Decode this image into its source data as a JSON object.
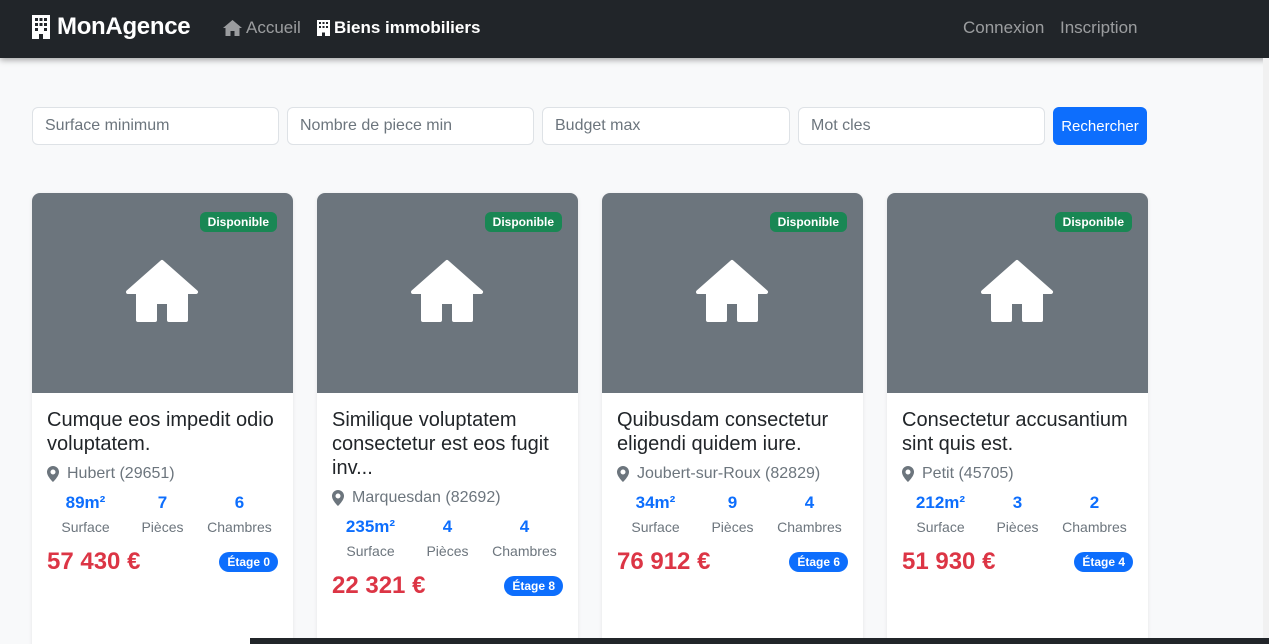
{
  "navbar": {
    "brand": "MonAgence",
    "links": [
      {
        "label": "Accueil"
      },
      {
        "label": "Biens immobiliers"
      }
    ],
    "auth": {
      "login": "Connexion",
      "signup": "Inscription"
    },
    "background": "#212529"
  },
  "search": {
    "surface_placeholder": "Surface minimum",
    "pieces_placeholder": "Nombre de piece min",
    "budget_placeholder": "Budget max",
    "keywords_placeholder": "Mot cles",
    "submit_label": "Rechercher"
  },
  "colors": {
    "primary": "#0d6efd",
    "success": "#198754",
    "danger": "#dc3545",
    "image_bg": "#6c757d"
  },
  "properties": [
    {
      "status": "Disponible",
      "title": "Cumque eos impedit odio voluptatem.",
      "location": "Hubert (29651)",
      "surface": "89m²",
      "surface_label": "Surface",
      "pieces": "7",
      "pieces_label": "Pièces",
      "chambres": "6",
      "chambres_label": "Chambres",
      "price": "57 430 €",
      "etage": "Étage 0"
    },
    {
      "status": "Disponible",
      "title": "Similique voluptatem consectetur est eos fugit inv...",
      "location": "Marquesdan (82692)",
      "surface": "235m²",
      "surface_label": "Surface",
      "pieces": "4",
      "pieces_label": "Pièces",
      "chambres": "4",
      "chambres_label": "Chambres",
      "price": "22 321 €",
      "etage": "Étage 8"
    },
    {
      "status": "Disponible",
      "title": "Quibusdam consectetur eligendi quidem iure.",
      "location": "Joubert-sur-Roux (82829)",
      "surface": "34m²",
      "surface_label": "Surface",
      "pieces": "9",
      "pieces_label": "Pièces",
      "chambres": "4",
      "chambres_label": "Chambres",
      "price": "76 912 €",
      "etage": "Étage 6"
    },
    {
      "status": "Disponible",
      "title": "Consectetur accusantium sint quis est.",
      "location": "Petit (45705)",
      "surface": "212m²",
      "surface_label": "Surface",
      "pieces": "3",
      "pieces_label": "Pièces",
      "chambres": "2",
      "chambres_label": "Chambres",
      "price": "51 930 €",
      "etage": "Étage 4"
    }
  ]
}
